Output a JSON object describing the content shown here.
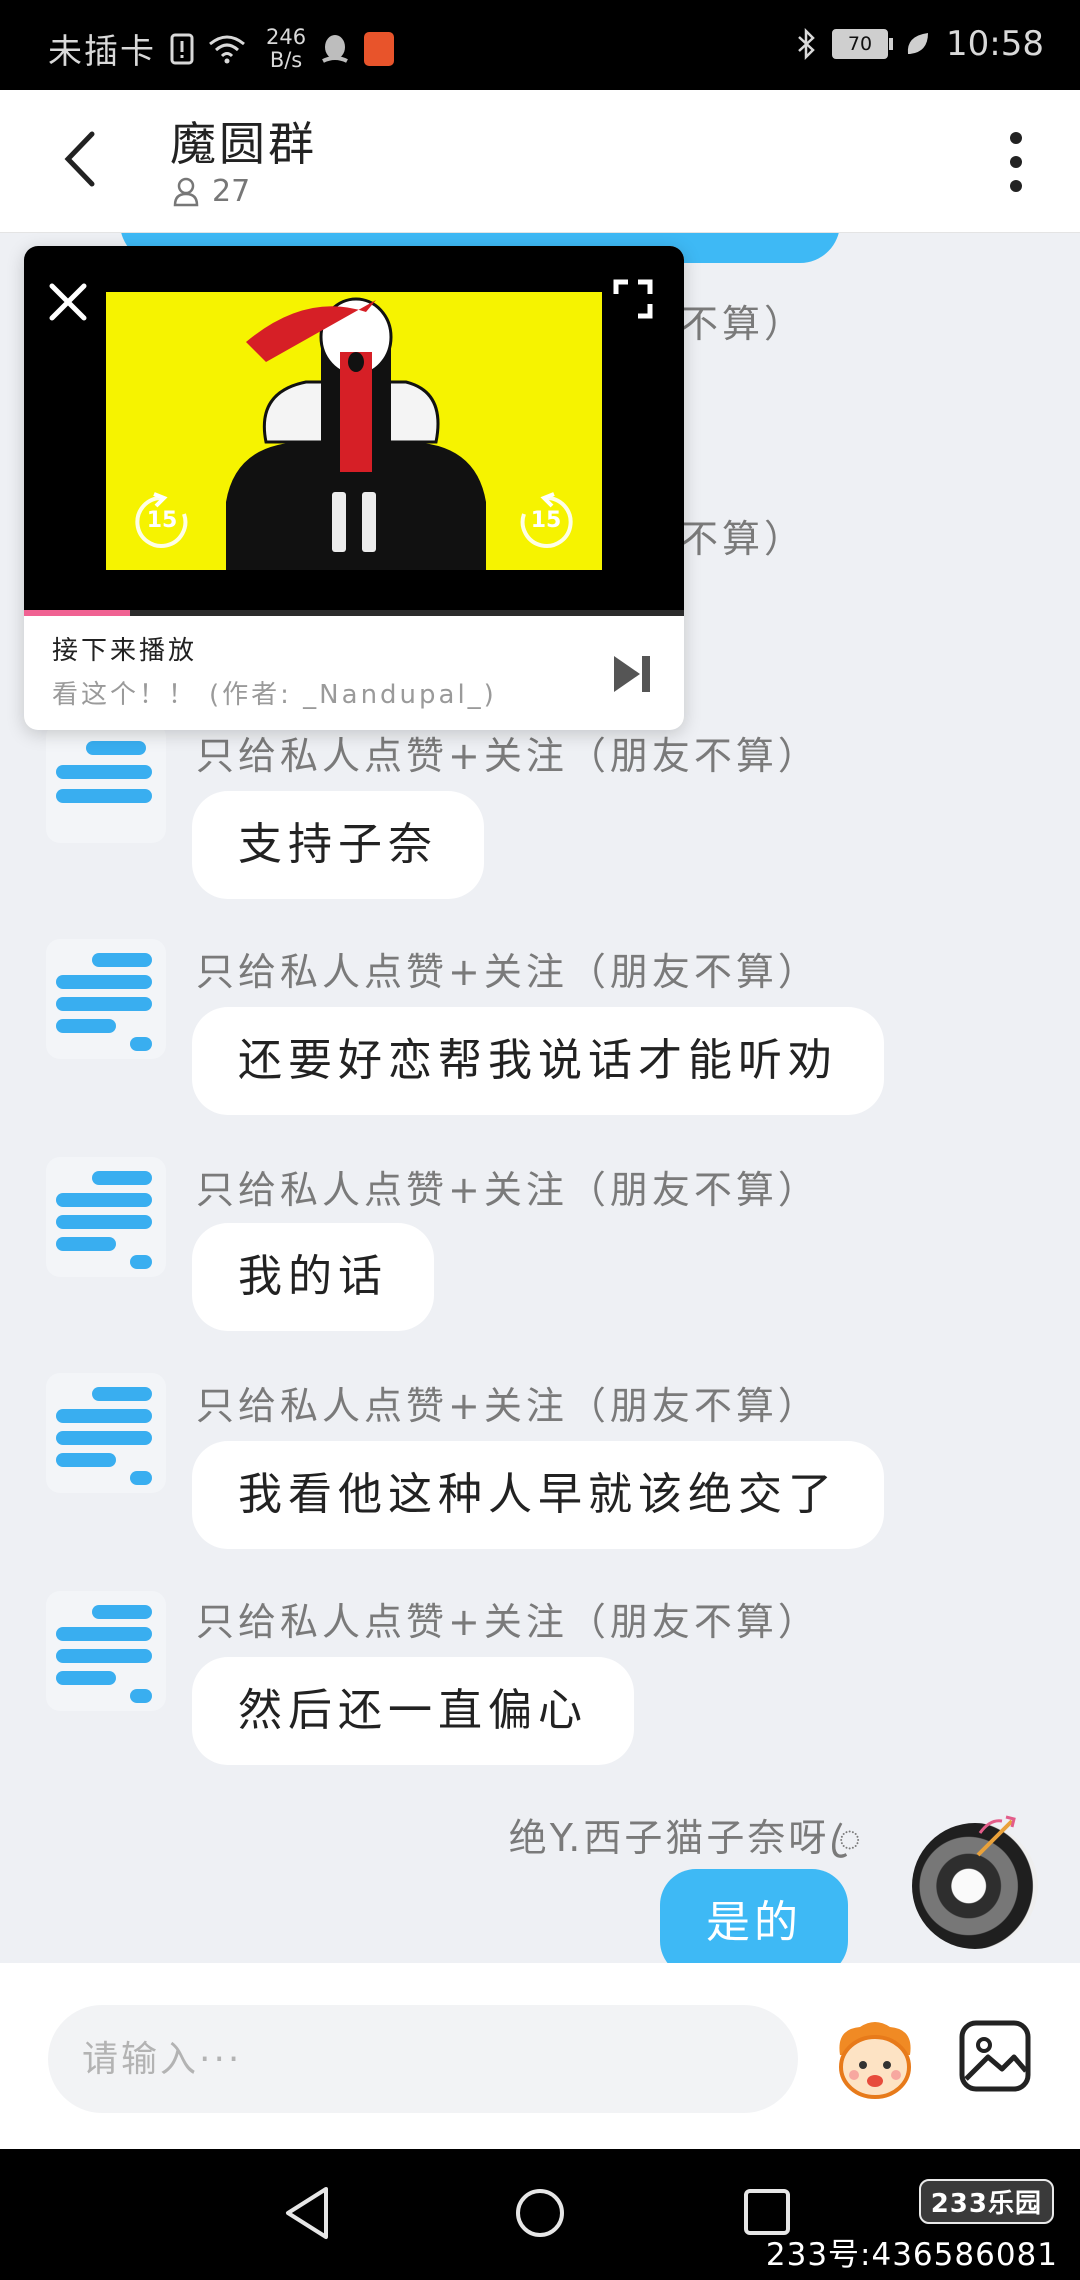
{
  "status_bar": {
    "sim_text": "未插卡",
    "speed_value": "246",
    "speed_unit": "B/s",
    "battery": "70",
    "time": "10:58",
    "icons": [
      "sim-alert-icon",
      "wifi-icon",
      "qq-icon",
      "app-notification-icon",
      "bluetooth-icon",
      "battery-icon",
      "leaf-icon"
    ]
  },
  "header": {
    "title": "魔圆群",
    "member_count": "27",
    "back_icon": "chevron-left-icon",
    "member_icon": "person-icon",
    "more_icon": "more-vertical-icon"
  },
  "player": {
    "up_next_label": "接下来播放",
    "up_next_title": "看这个！！",
    "up_next_credit": "(作者: _Nandupal_)",
    "progress": 0.16,
    "rewind_label": "15",
    "forward_label": "15",
    "icons": [
      "close-icon",
      "fullscreen-icon",
      "rewind-15-icon",
      "pause-icon",
      "forward-15-icon",
      "skip-next-icon"
    ]
  },
  "messages": [
    {
      "nickname": "只给私人点赞+关注（朋友不算）",
      "text": "支持子奈"
    },
    {
      "nickname": "只给私人点赞+关注（朋友不算）",
      "text": "还要好恋帮我说话才能听劝"
    },
    {
      "nickname": "只给私人点赞+关注（朋友不算）",
      "text": "我的话"
    },
    {
      "nickname": "只给私人点赞+关注（朋友不算）",
      "text": "我看他这种人早就该绝交了"
    },
    {
      "nickname": "只给私人点赞+关注（朋友不算）",
      "text": "然后还一直偏心"
    }
  ],
  "hidden_nickname_fragment_1": "不算）",
  "hidden_nickname_fragment_2": "不算）",
  "self_message": {
    "nickname": "绝Y.西子猫子奈呀ꦿ",
    "text": "是的"
  },
  "input": {
    "placeholder": "请输入···"
  },
  "navbar": {
    "icons": [
      "nav-back-icon",
      "nav-home-icon",
      "nav-recent-icon"
    ]
  },
  "watermark": {
    "logo": "233乐园",
    "id_text": "233号:436586081"
  },
  "colors": {
    "accent_bubble": "#3eb9f5",
    "chat_background": "#eef0f4",
    "progress": "#f06292",
    "video_background": "#f6f300"
  }
}
